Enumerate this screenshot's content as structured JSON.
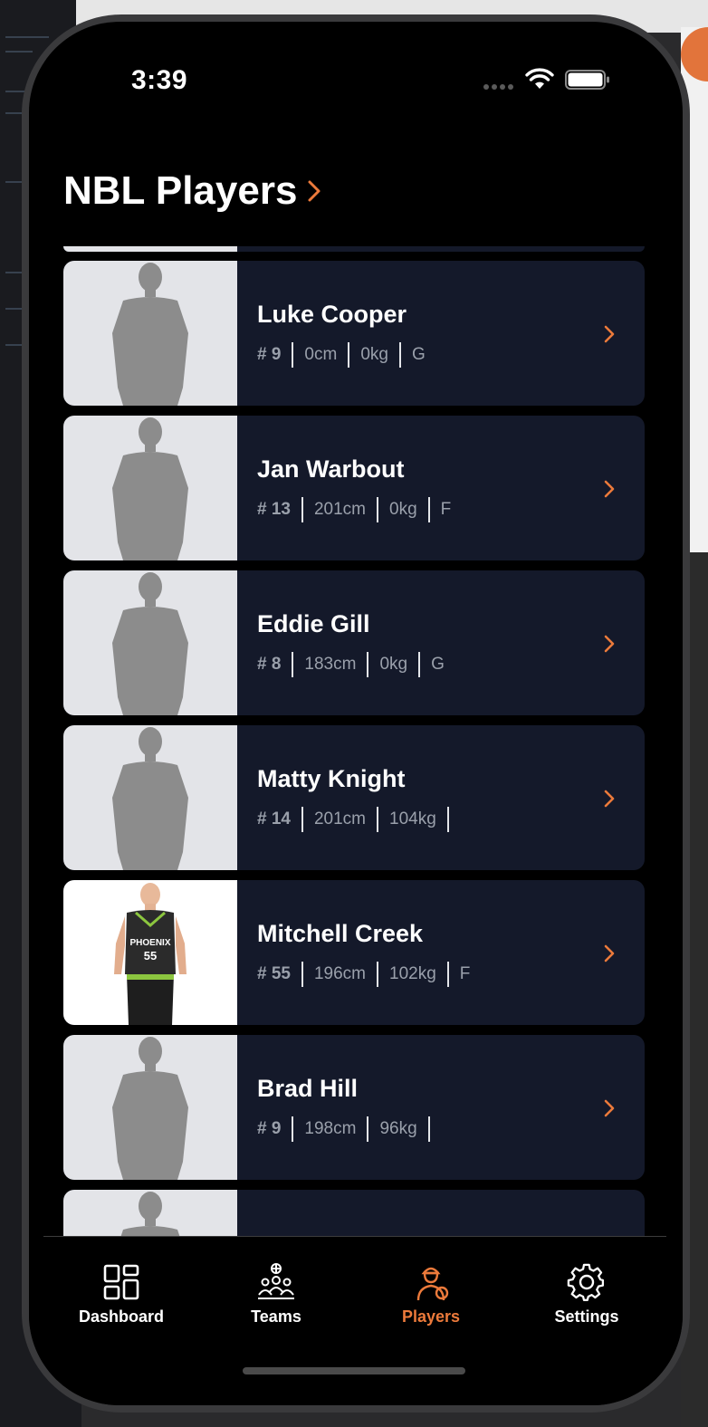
{
  "status_bar": {
    "time": "3:39"
  },
  "header": {
    "title": "NBL Players"
  },
  "players": [
    {
      "name": "Luke Cooper",
      "number": "# 9",
      "height": "0cm",
      "weight": "0kg",
      "position": "G",
      "photo": "placeholder"
    },
    {
      "name": "Jan Warbout",
      "number": "# 13",
      "height": "201cm",
      "weight": "0kg",
      "position": "F",
      "photo": "placeholder"
    },
    {
      "name": "Eddie Gill",
      "number": "# 8",
      "height": "183cm",
      "weight": "0kg",
      "position": "G",
      "photo": "placeholder"
    },
    {
      "name": "Matty Knight",
      "number": "# 14",
      "height": "201cm",
      "weight": "104kg",
      "position": "",
      "photo": "placeholder"
    },
    {
      "name": "Mitchell Creek",
      "number": "# 55",
      "height": "196cm",
      "weight": "102kg",
      "position": "F",
      "photo": "player-photo"
    },
    {
      "name": "Brad Hill",
      "number": "# 9",
      "height": "198cm",
      "weight": "96kg",
      "position": "",
      "photo": "placeholder"
    }
  ],
  "tabs": [
    {
      "label": "Dashboard",
      "icon": "dashboard-icon",
      "active": false
    },
    {
      "label": "Teams",
      "icon": "teams-icon",
      "active": false
    },
    {
      "label": "Players",
      "icon": "players-icon",
      "active": true
    },
    {
      "label": "Settings",
      "icon": "gear-icon",
      "active": false
    }
  ],
  "colors": {
    "accent": "#ec7a3b",
    "background": "#000000",
    "card": "#14192a",
    "meta_text": "#9aa0ab",
    "placeholder_bg": "#e3e4e8"
  }
}
